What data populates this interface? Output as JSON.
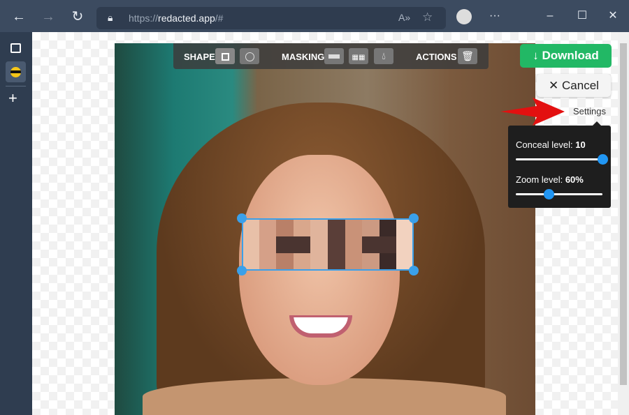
{
  "browser": {
    "url_prefix": "https://",
    "url_domain": "redacted.app",
    "url_suffix": "/#"
  },
  "toolbar": {
    "shape_label": "SHAPE",
    "masking_label": "MASKING",
    "actions_label": "ACTIONS"
  },
  "buttons": {
    "download": "Download",
    "cancel": "Cancel"
  },
  "settings": {
    "label": "Settings",
    "conceal_label": "Conceal level:",
    "conceal_value": "10",
    "conceal_fraction": 1.0,
    "zoom_label": "Zoom level:",
    "zoom_value": "60%",
    "zoom_fraction": 0.38
  },
  "colors": {
    "accent": "#22b865",
    "selection": "#3aa0ea",
    "slider": "#2196f3",
    "arrow": "#e31010"
  }
}
